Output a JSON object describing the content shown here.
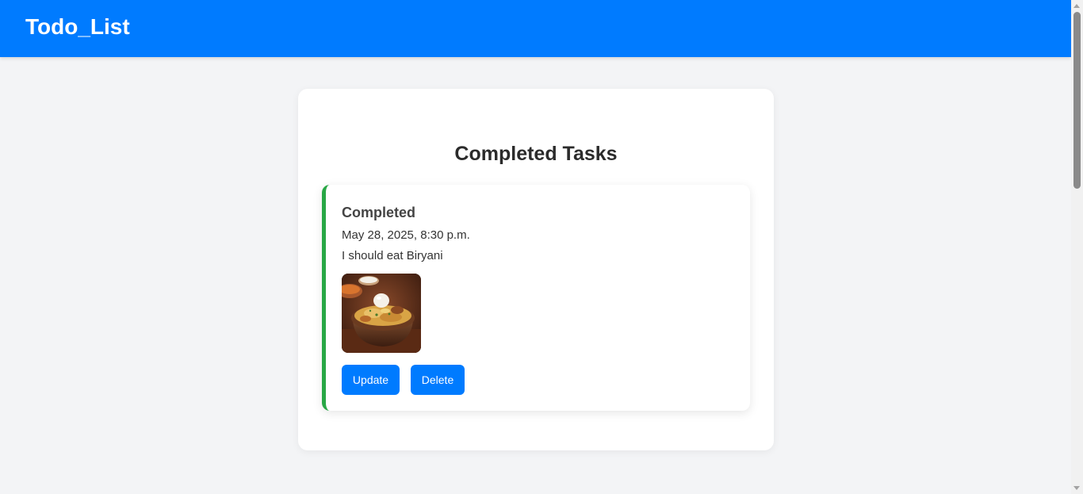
{
  "navbar": {
    "brand": "Todo_List",
    "accent_color": "#007bff"
  },
  "main": {
    "title": "Completed Tasks"
  },
  "tasks": [
    {
      "status": "Completed",
      "datetime": "May 28, 2025, 8:30 p.m.",
      "description": "I should eat Biryani",
      "image_icon": "biryani-photo",
      "status_color": "#28a745",
      "update_label": "Update",
      "delete_label": "Delete"
    }
  ]
}
